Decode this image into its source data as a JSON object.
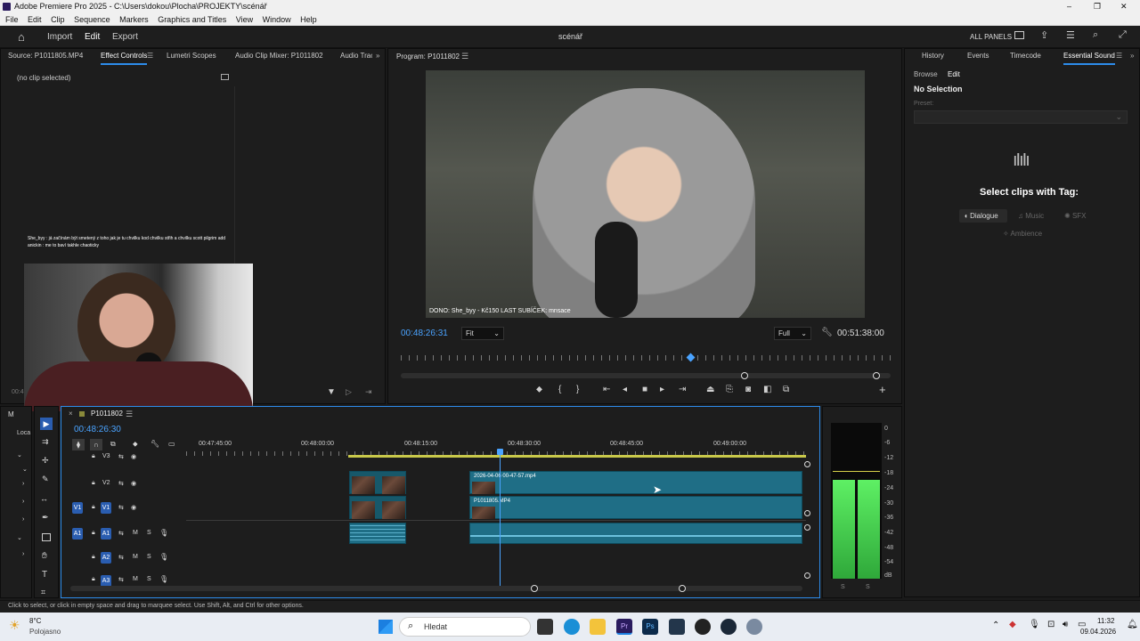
{
  "window": {
    "title": "Adobe Premiere Pro 2025 - C:\\Users\\dokou\\Plocha\\PROJEKTY\\scénář",
    "minimize": "–",
    "maximize": "❐",
    "close": "✕"
  },
  "menu": [
    "File",
    "Edit",
    "Clip",
    "Sequence",
    "Markers",
    "Graphics and Titles",
    "View",
    "Window",
    "Help"
  ],
  "appbar": {
    "import": "Import",
    "edit": "Edit",
    "export": "Export",
    "project": "scénář",
    "all_panels": "ALL PANELS"
  },
  "source_panel": {
    "tabs": [
      "Source: P1011805.MP4",
      "Effect Controls",
      "Lumetri Scopes",
      "Audio Clip Mixer: P1011802",
      "Audio Track"
    ],
    "active_tab": 1,
    "no_clip": "(no clip selected)",
    "chat_line1": "She_byy : já začínám být smetený z toho jak je tu chvilku kod chvilku střih a chvilku scott pilgrim add",
    "chat_line2": "anickin : me to baví takhle chaoticky",
    "time_partial": "00:4"
  },
  "program": {
    "title": "Program: P1011802",
    "overlay": "DONO: She_byy - Kč150  LAST SUBÍČEK: mnsace",
    "current_time": "00:48:26:31",
    "fit": "Fit",
    "quality": "Full",
    "duration": "00:51:38:00"
  },
  "right_panel": {
    "tabs": [
      "History",
      "Events",
      "Timecode",
      "Essential Sound"
    ],
    "subtabs": [
      "Browse",
      "Edit"
    ],
    "no_selection": "No Selection",
    "preset_label": "Preset:",
    "heading": "Select clips with Tag:",
    "tags": [
      "Dialogue",
      "Music",
      "SFX",
      "Ambience"
    ]
  },
  "timeline": {
    "sequence": "P1011802",
    "timecode": "00:48:26:30",
    "ruler": [
      "00:47:45:00",
      "00:48:00:00",
      "00:48:15:00",
      "00:48:30:00",
      "00:48:45:00",
      "00:49:00:00"
    ],
    "tracks": [
      "V3",
      "V2",
      "V1",
      "A1",
      "A2",
      "A3"
    ],
    "clip_v2": "2026-04-06 00-47-57.mp4",
    "clip_v1": "P1011805.MP4",
    "project_tab": "M",
    "project_label": "Loca"
  },
  "meter": {
    "labels": [
      "0",
      "-6",
      "-12",
      "-18",
      "-24",
      "-30",
      "-36",
      "-42",
      "-48",
      "-54",
      "dB"
    ],
    "solo": "S"
  },
  "status": "Click to select, or click in empty space and drag to marquee select. Use Shift, Alt, and Ctrl for other options.",
  "taskbar": {
    "temp": "8°C",
    "weather": "Polojasno",
    "search": "Hledat",
    "time": "11:32",
    "date": "09.04.2026"
  },
  "colors": {
    "accent": "#2d8ceb",
    "clip": "#1f6e86",
    "meter": "#3fd14a"
  }
}
